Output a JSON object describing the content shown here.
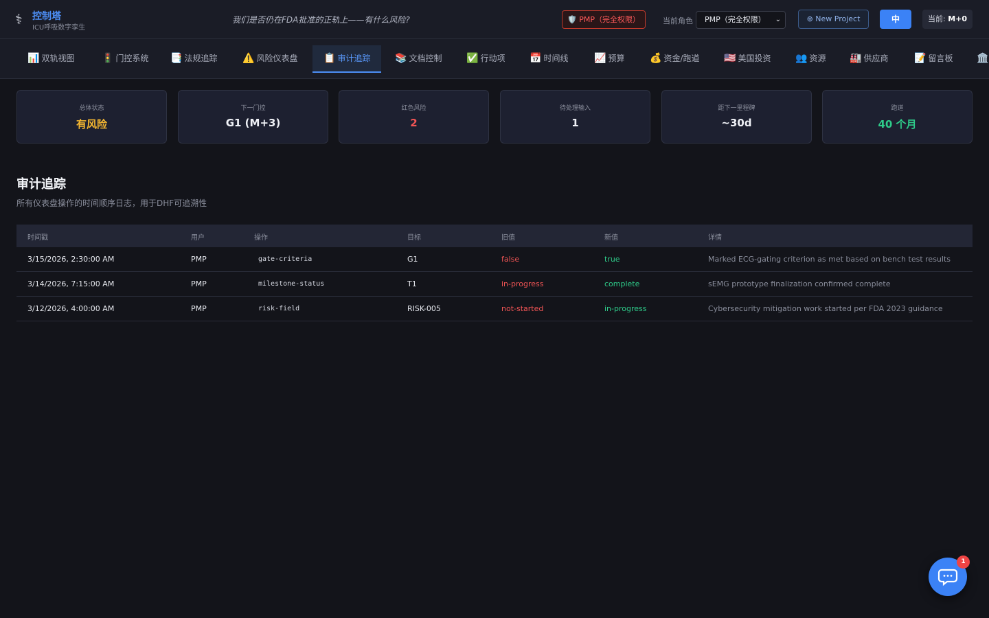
{
  "header": {
    "logo_icon": "⚕",
    "title": "控制塔",
    "subtitle": "ICU呼吸数字孪生",
    "tagline": "我们是否仍在FDA批准的正轨上——有什么风险?",
    "role_badge": "🛡️ PMP（完全权限）",
    "role_label": "当前角色",
    "role_select_value": "PMP（完全权限）",
    "new_project": "⊕ New Project",
    "lang_button": "中",
    "current_prefix": "当前: ",
    "current_value": "M+0"
  },
  "tabs": [
    {
      "icon": "📊",
      "label": "双轨视图"
    },
    {
      "icon": "🚦",
      "label": "门控系统"
    },
    {
      "icon": "📑",
      "label": "法规追踪"
    },
    {
      "icon": "⚠️",
      "label": "风险仪表盘"
    },
    {
      "icon": "📋",
      "label": "审计追踪"
    },
    {
      "icon": "📚",
      "label": "文档控制"
    },
    {
      "icon": "✅",
      "label": "行动项"
    },
    {
      "icon": "📅",
      "label": "时间线"
    },
    {
      "icon": "📈",
      "label": "预算"
    },
    {
      "icon": "💰",
      "label": "资金/跑道"
    },
    {
      "icon": "🇺🇸",
      "label": "美国投资"
    },
    {
      "icon": "👥",
      "label": "资源"
    },
    {
      "icon": "🏭",
      "label": "供应商"
    },
    {
      "icon": "📝",
      "label": "留言板"
    },
    {
      "icon": "🏛️",
      "label": ""
    }
  ],
  "kpis": [
    {
      "label": "总体状态",
      "value": "有风险",
      "color": "#f5b731"
    },
    {
      "label": "下一门控",
      "value": "G1 (M+3)",
      "color": "#f0f2f7"
    },
    {
      "label": "红色风险",
      "value": "2",
      "color": "#f25555"
    },
    {
      "label": "待处理输入",
      "value": "1",
      "color": "#f0f2f7"
    },
    {
      "label": "距下一里程碑",
      "value": "~30d",
      "color": "#f0f2f7"
    },
    {
      "label": "跑道",
      "value": "40 个月",
      "color": "#2ecc8a"
    }
  ],
  "section": {
    "title": "审计追踪",
    "subtitle": "所有仪表盘操作的时间顺序日志，用于DHF可追溯性"
  },
  "table": {
    "headers": [
      "时间戳",
      "用户",
      "操作",
      "目标",
      "旧值",
      "新值",
      "详情"
    ],
    "rows": [
      [
        "3/15/2026, 2:30:00 AM",
        "PMP",
        "gate-criteria",
        "G1",
        "false",
        "true",
        "Marked ECG-gating criterion as met based on bench test results"
      ],
      [
        "3/14/2026, 7:15:00 AM",
        "PMP",
        "milestone-status",
        "T1",
        "in-progress",
        "complete",
        "sEMG prototype finalization confirmed complete"
      ],
      [
        "3/12/2026, 4:00:00 AM",
        "PMP",
        "risk-field",
        "RISK-005",
        "not-started",
        "in-progress",
        "Cybersecurity mitigation work started per FDA 2023 guidance"
      ]
    ]
  },
  "chat": {
    "badge": "1"
  }
}
